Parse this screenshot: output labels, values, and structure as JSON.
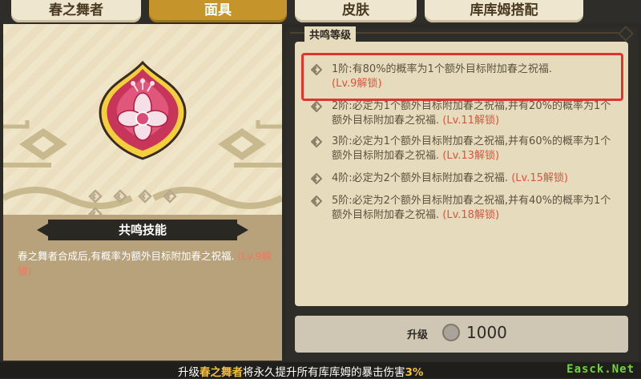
{
  "tabs": [
    {
      "label": "春之舞者",
      "active": false
    },
    {
      "label": "面具",
      "active": true
    },
    {
      "label": "皮肤",
      "active": false
    },
    {
      "label": "库库姆搭配",
      "active": false
    }
  ],
  "left": {
    "mask_icon": "pink-flower-mask-icon",
    "level_pips": 5,
    "skill_title": "共鸣技能",
    "skill_desc": "春之舞者合成后,有概率为额外目标附加春之祝福.",
    "skill_unlock": "(Lv.9解锁)"
  },
  "right": {
    "section_title": "共鸣等级",
    "tiers": [
      {
        "text": "1阶:有80%的概率为1个额外目标附加春之祝福.",
        "unlock": "(Lv.9解锁)"
      },
      {
        "text": "2阶:必定为1个额外目标附加春之祝福,并有20%的概率为1个额外目标附加春之祝福.",
        "unlock": "(Lv.11解锁)"
      },
      {
        "text": "3阶:必定为1个额外目标附加春之祝福,并有60%的概率为1个额外目标附加春之祝福.",
        "unlock": "(Lv.13解锁)"
      },
      {
        "text": "4阶:必定为2个额外目标附加春之祝福.",
        "unlock": "(Lv.15解锁)"
      },
      {
        "text": "5阶:必定为2个额外目标附加春之祝福,并有40%的概率为1个额外目标附加春之祝福.",
        "unlock": "(Lv.18解锁)"
      }
    ],
    "upgrade_label": "升级",
    "upgrade_cost": "1000"
  },
  "bottom": {
    "prefix": "升级",
    "name": "春之舞者",
    "middle": "将永久提升所有库库姆的暴击伤害",
    "value": "3%",
    "watermark": "Easck.Net"
  },
  "colors": {
    "active_tab": "#c5942a",
    "unlock_red": "#e0523c",
    "highlight": "#e2342f",
    "accent_yellow": "#f2c03c"
  }
}
